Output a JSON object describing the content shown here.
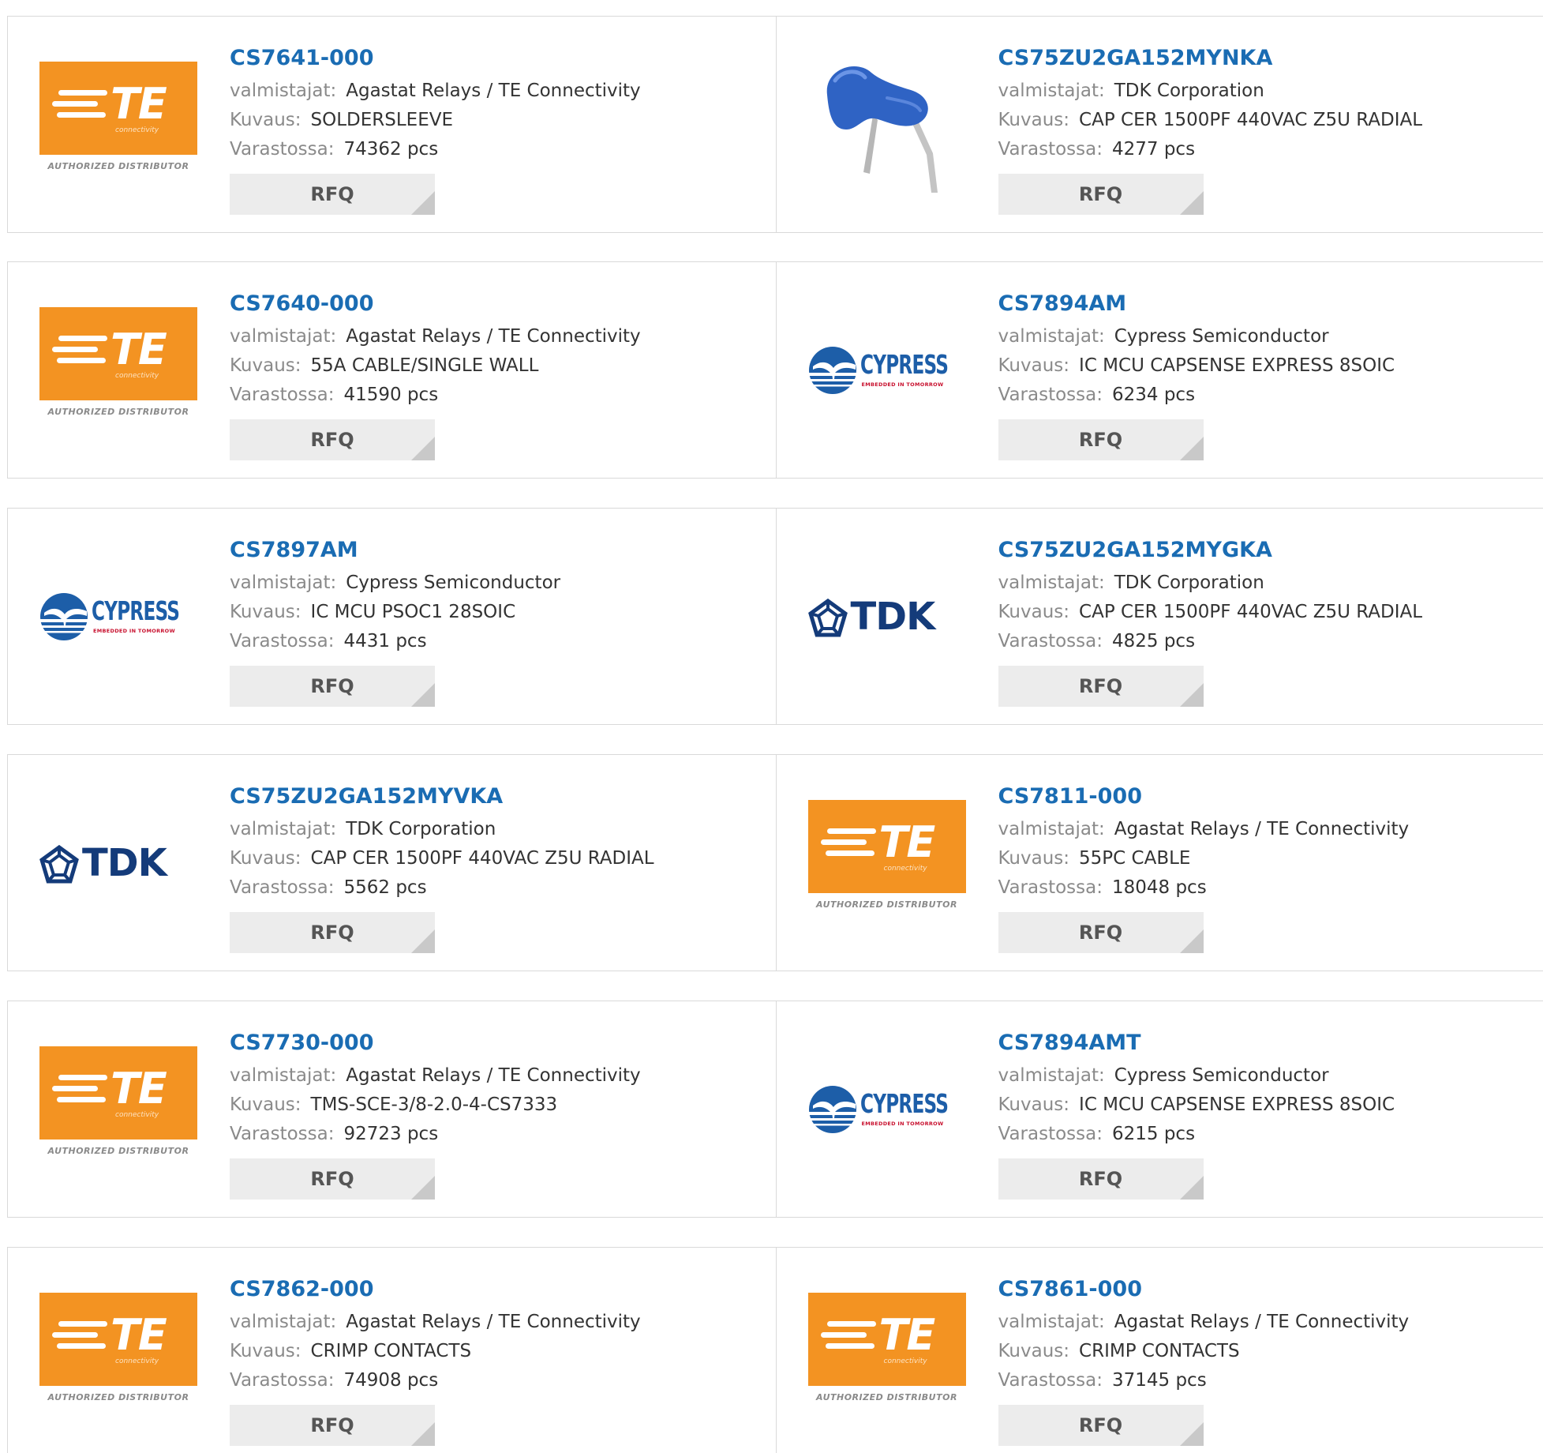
{
  "labels": {
    "manufacturer": "valmistajat:",
    "description": "Kuvaus:",
    "stock": "Varastossa:"
  },
  "rfq_label": "RFQ",
  "logos": {
    "te_authorized": "AUTHORIZED DISTRIBUTOR",
    "te_word": "TE",
    "te_sub": "connectivity",
    "cypress_word": "CYPRESS",
    "cypress_tag": "EMBEDDED IN TOMORROW",
    "tdk_word": "TDK"
  },
  "products": [
    {
      "part": "CS7641-000",
      "manufacturer": "Agastat Relays / TE Connectivity",
      "description": "SOLDERSLEEVE",
      "stock": "74362 pcs",
      "image": "te"
    },
    {
      "part": "CS75ZU2GA152MYNKA",
      "manufacturer": "TDK Corporation",
      "description": "CAP CER 1500PF 440VAC Z5U RADIAL",
      "stock": "4277 pcs",
      "image": "capacitor"
    },
    {
      "part": "CS7640-000",
      "manufacturer": "Agastat Relays / TE Connectivity",
      "description": "55A CABLE/SINGLE WALL",
      "stock": "41590 pcs",
      "image": "te"
    },
    {
      "part": "CS7894AM",
      "manufacturer": "Cypress Semiconductor",
      "description": "IC MCU CAPSENSE EXPRESS 8SOIC",
      "stock": "6234 pcs",
      "image": "cypress"
    },
    {
      "part": "CS7897AM",
      "manufacturer": "Cypress Semiconductor",
      "description": "IC MCU PSOC1 28SOIC",
      "stock": "4431 pcs",
      "image": "cypress"
    },
    {
      "part": "CS75ZU2GA152MYGKA",
      "manufacturer": "TDK Corporation",
      "description": "CAP CER 1500PF 440VAC Z5U RADIAL",
      "stock": "4825 pcs",
      "image": "tdk"
    },
    {
      "part": "CS75ZU2GA152MYVKA",
      "manufacturer": "TDK Corporation",
      "description": "CAP CER 1500PF 440VAC Z5U RADIAL",
      "stock": "5562 pcs",
      "image": "tdk"
    },
    {
      "part": "CS7811-000",
      "manufacturer": "Agastat Relays / TE Connectivity",
      "description": "55PC CABLE",
      "stock": "18048 pcs",
      "image": "te"
    },
    {
      "part": "CS7730-000",
      "manufacturer": "Agastat Relays / TE Connectivity",
      "description": "TMS-SCE-3/8-2.0-4-CS7333",
      "stock": "92723 pcs",
      "image": "te"
    },
    {
      "part": "CS7894AMT",
      "manufacturer": "Cypress Semiconductor",
      "description": "IC MCU CAPSENSE EXPRESS 8SOIC",
      "stock": "6215 pcs",
      "image": "cypress"
    },
    {
      "part": "CS7862-000",
      "manufacturer": "Agastat Relays / TE Connectivity",
      "description": "CRIMP CONTACTS",
      "stock": "74908 pcs",
      "image": "te"
    },
    {
      "part": "CS7861-000",
      "manufacturer": "Agastat Relays / TE Connectivity",
      "description": "CRIMP CONTACTS",
      "stock": "37145 pcs",
      "image": "te"
    }
  ]
}
